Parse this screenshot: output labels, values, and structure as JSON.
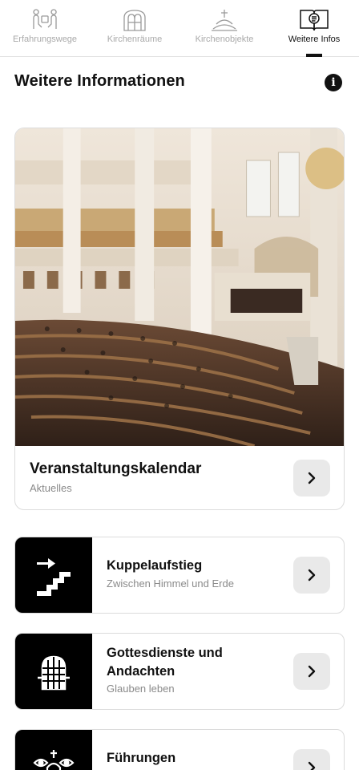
{
  "tabs": [
    {
      "label": "Erfahrungswege",
      "icon": "hands-icon",
      "active": false
    },
    {
      "label": "Kirchenräume",
      "icon": "church-window-icon",
      "active": false
    },
    {
      "label": "Kirchenobjekte",
      "icon": "altar-cross-icon",
      "active": false
    },
    {
      "label": "Weitere Infos",
      "icon": "book-info-icon",
      "active": true
    }
  ],
  "page": {
    "title": "Weitere Informationen"
  },
  "featured": {
    "title": "Veranstaltungskalendar",
    "subtitle": "Aktuelles",
    "image": "church-interior-concert-photo"
  },
  "items": [
    {
      "title": "Kuppelaufstieg",
      "subtitle": "Zwischen Himmel und Erde",
      "icon": "stairs-arrow-icon"
    },
    {
      "title": "Gottesdienste und Andachten",
      "subtitle": "Glauben leben",
      "icon": "church-window-icon"
    },
    {
      "title": "Führungen",
      "subtitle": "",
      "icon": "church-eyes-icon"
    }
  ],
  "colors": {
    "accent": "#111111",
    "muted": "#8a8a8a",
    "button_bg": "#e9e9e9",
    "border": "#dcdcdc"
  }
}
